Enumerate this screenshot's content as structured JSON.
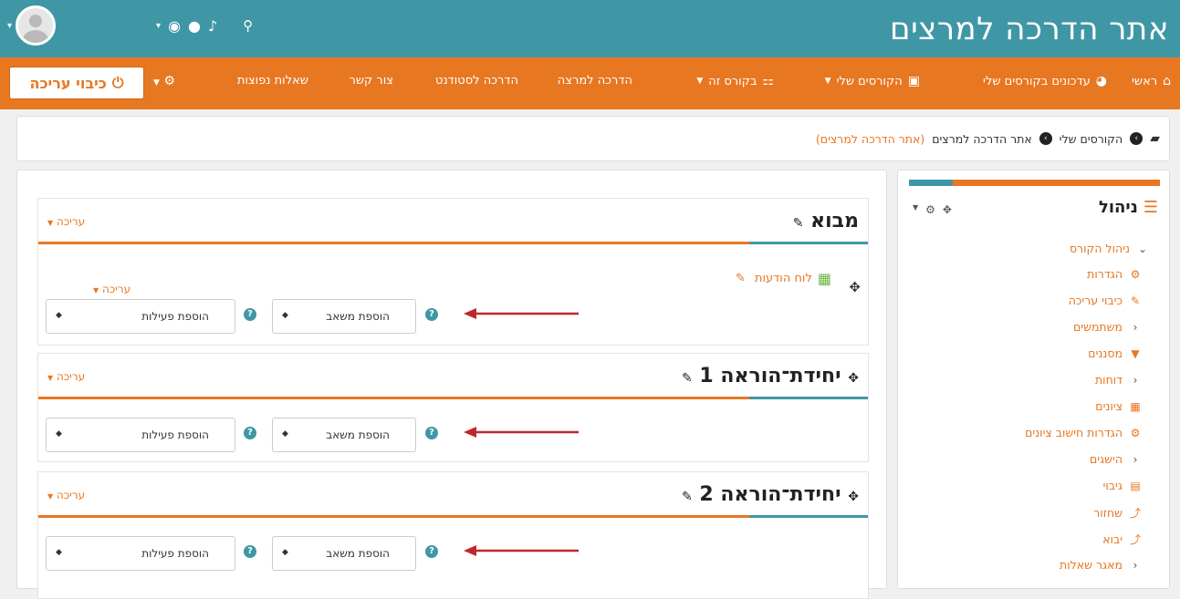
{
  "header": {
    "site_title": "אתר הדרכה למרצים"
  },
  "nav": {
    "home": "ראשי",
    "updates": "עדכונים בקורסים שלי",
    "my_courses": "הקורסים שלי",
    "this_course": "בקורס זה",
    "lecturer_guide": "הדרכה למרצה",
    "student_guide": "הדרכה לסטודנט",
    "contact": "צור קשר",
    "faq": "שאלות נפוצות",
    "edit_off": "כיבוי עריכה"
  },
  "breadcrumb": {
    "my_courses": "הקורסים שלי",
    "site": "אתר הדרכה למרצים",
    "site_link": "(אתר הדרכה למרצים)"
  },
  "sections": [
    {
      "title": "מבוא",
      "edit": "עריכה",
      "activity": {
        "name": "לוח הודעות",
        "edit": "עריכה"
      },
      "add_resource": "הוספת משאב",
      "add_activity": "הוספת פעילות"
    },
    {
      "title": "יחידת־הוראה 1",
      "edit": "עריכה",
      "add_resource": "הוספת משאב",
      "add_activity": "הוספת פעילות"
    },
    {
      "title": "יחידת־הוראה 2",
      "edit": "עריכה",
      "add_resource": "הוספת משאב",
      "add_activity": "הוספת פעילות"
    }
  ],
  "sidebar": {
    "title": "ניהול",
    "items": [
      {
        "label": "ניהול הקורס",
        "icon": "chevron-down-icon"
      },
      {
        "label": "הגדרות",
        "icon": "gear-icon"
      },
      {
        "label": "כיבוי עריכה",
        "icon": "pencil-icon"
      },
      {
        "label": "משתמשים",
        "icon": "chevron-left-icon"
      },
      {
        "label": "מסננים",
        "icon": "filter-icon"
      },
      {
        "label": "דוחות",
        "icon": "chevron-left-icon"
      },
      {
        "label": "ציונים",
        "icon": "table-icon"
      },
      {
        "label": "הגדרות חישוב ציונים",
        "icon": "gear-icon"
      },
      {
        "label": "הישגים",
        "icon": "chevron-left-icon"
      },
      {
        "label": "גיבוי",
        "icon": "file-icon"
      },
      {
        "label": "שחזור",
        "icon": "upload-icon"
      },
      {
        "label": "יבוא",
        "icon": "upload-icon"
      },
      {
        "label": "מאגר שאלות",
        "icon": "chevron-left-icon"
      }
    ]
  },
  "colors": {
    "teal": "#3f97a6",
    "orange": "#e87722",
    "arrow_red": "#c0272d"
  }
}
